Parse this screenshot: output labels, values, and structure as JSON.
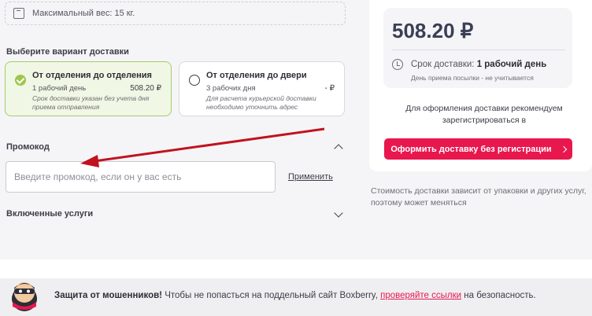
{
  "weight": {
    "icon": "weight-icon",
    "text": "Максимальный вес: 15 кг."
  },
  "delivery": {
    "title": "Выберите вариант доставки",
    "options": [
      {
        "title": "От отделения до отделения",
        "days": "1 рабочий день",
        "price": "508.20 ₽",
        "note": "Срок доставки указан без учета дня приема отправления",
        "selected": true
      },
      {
        "title": "От отделения до двери",
        "days": "3 рабочих дня",
        "price": "- ₽",
        "note": "Для расчета курьерской доставки необходимо уточнить адрес",
        "selected": false
      }
    ]
  },
  "promo": {
    "title": "Промокод",
    "placeholder": "Введите промокод, если он у вас есть",
    "value": "",
    "apply_label": "Применить"
  },
  "services": {
    "title": "Включенные услуги"
  },
  "summary": {
    "price": "508.20 ₽",
    "term_label": "Срок доставки:",
    "term_value": "1 рабочий день",
    "term_note": "День приема посылки - не учитывается",
    "recommend": "Для оформления доставки рекомендуем зарегистрироваться в",
    "order_button": "Оформить доставку без регистрации",
    "cost_note": "Стоимость доставки зависит от упаковки и других услуг, поэтому может меняться"
  },
  "fraud": {
    "bold": "Защита от мошенников!",
    "text_before": " Чтобы не попасться на поддельный сайт Boxberry, ",
    "link": "проверяйте ссылки",
    "text_after": " на безопасность."
  },
  "colors": {
    "accent": "#e8174e",
    "selected_bg": "#f0f7e4",
    "selected_border": "#a8c96b",
    "check": "#9fc54e",
    "annotation_arrow": "#c1121f"
  }
}
